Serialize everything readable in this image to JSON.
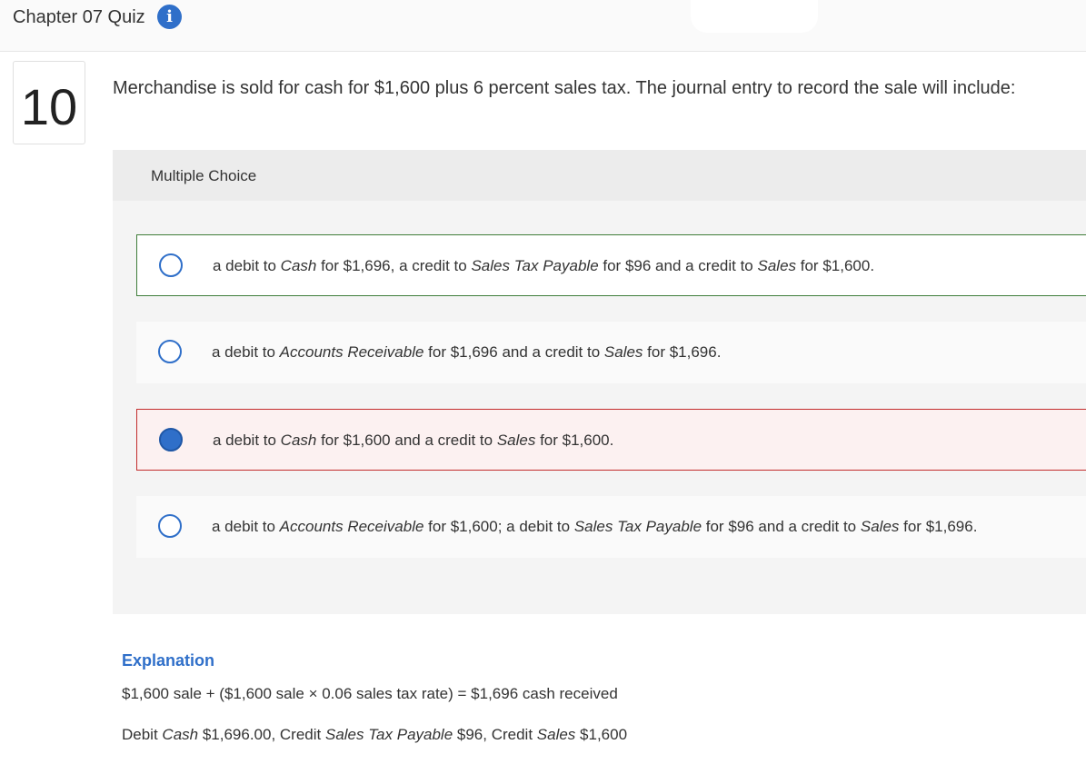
{
  "header": {
    "title": "Chapter 07 Quiz",
    "info_icon": "info-icon"
  },
  "question": {
    "number": "10",
    "prompt": "Merchandise is sold for cash for $1,600 plus 6 percent sales tax. The journal entry to record the sale will include:",
    "type_label": "Multiple Choice"
  },
  "choices": [
    {
      "state": "correct-answer",
      "selected": false,
      "parts": [
        "a debit to ",
        "Cash",
        " for $1,696, a credit to ",
        "Sales Tax Payable",
        " for $96 and a credit to ",
        "Sales",
        " for $1,600."
      ]
    },
    {
      "state": "none",
      "selected": false,
      "parts": [
        "a debit to ",
        "Accounts Receivable",
        " for $1,696 and a credit to ",
        "Sales",
        " for $1,696."
      ]
    },
    {
      "state": "incorrect-selected",
      "selected": true,
      "parts": [
        "a debit to ",
        "Cash",
        " for $1,600 and a credit to ",
        "Sales",
        " for $1,600."
      ]
    },
    {
      "state": "none",
      "selected": false,
      "parts": [
        "a debit to ",
        "Accounts Receivable",
        " for $1,600; a debit to ",
        "Sales Tax Payable",
        " for $96 and a credit to ",
        "Sales",
        " for $1,696."
      ]
    }
  ],
  "explanation": {
    "title": "Explanation",
    "line1": "$1,600 sale + ($1,600 sale × 0.06 sales tax rate) = $1,696 cash received",
    "line2_parts": [
      "Debit ",
      "Cash",
      " $1,696.00, Credit ",
      "Sales Tax Payable",
      " $96, Credit ",
      "Sales",
      " $1,600"
    ]
  },
  "colors": {
    "accent": "#2f6fc9",
    "correct_border": "#3f7d3a",
    "wrong_border": "#c22d2d",
    "wrong_bg": "#fcf1f1"
  }
}
